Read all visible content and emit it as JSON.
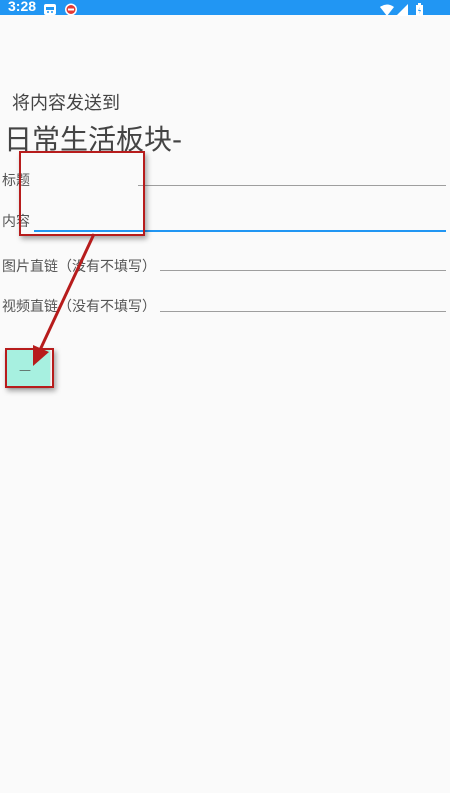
{
  "status_bar": {
    "time": "3:28",
    "left_icons": [
      "notification-app-icon",
      "notification-red-icon"
    ],
    "right_icons": [
      "wifi-icon",
      "signal-icon",
      "battery-icon"
    ],
    "color": "#2196f3"
  },
  "page": {
    "subtitle": "将内容发送到",
    "section": "日常生活板块-"
  },
  "form": {
    "title_label": "标题",
    "title_value": "",
    "content_label": "内容",
    "content_value": "",
    "image_label": "图片直链（没有不填写）",
    "image_value": "",
    "video_label": "视频直链（没有不填写）",
    "video_value": "",
    "send_label": "—"
  },
  "colors": {
    "accent": "#2196f3",
    "button": "#a7f0e0",
    "annotation": "#b71c1c"
  }
}
